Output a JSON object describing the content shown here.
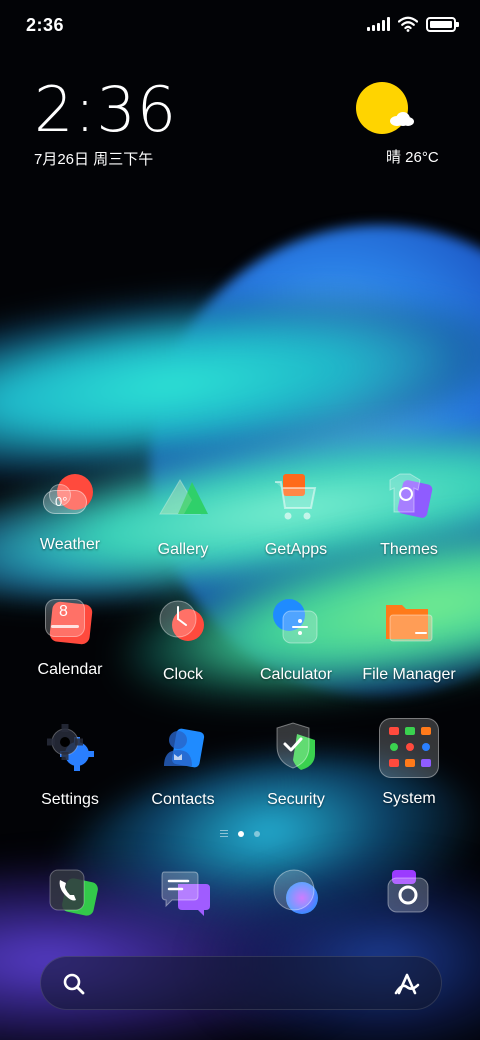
{
  "status_bar": {
    "time": "2:36",
    "icons": [
      "signal-icon",
      "wifi-icon",
      "battery-icon"
    ],
    "battery_level": 1.0
  },
  "clock_widget": {
    "time": "2:36",
    "date": "7月26日 周三下午"
  },
  "weather_widget": {
    "icon": "sun-cloud-icon",
    "text": "晴 26°C",
    "sun_color": "#ffd400"
  },
  "apps": [
    {
      "label": "Weather",
      "icon": "weather-icon",
      "badge": "0°"
    },
    {
      "label": "Gallery",
      "icon": "gallery-icon"
    },
    {
      "label": "GetApps",
      "icon": "getapps-icon"
    },
    {
      "label": "Themes",
      "icon": "themes-icon"
    },
    {
      "label": "Calendar",
      "icon": "calendar-icon",
      "badge": "8"
    },
    {
      "label": "Clock",
      "icon": "clock-icon"
    },
    {
      "label": "Calculator",
      "icon": "calculator-icon"
    },
    {
      "label": "File Manager",
      "icon": "file-manager-icon"
    },
    {
      "label": "Settings",
      "icon": "settings-icon"
    },
    {
      "label": "Contacts",
      "icon": "contacts-icon"
    },
    {
      "label": "Security",
      "icon": "security-icon"
    },
    {
      "label": "System",
      "icon": "system-folder-icon"
    }
  ],
  "page_indicator": {
    "pages": 2,
    "active_page": 1
  },
  "dock": [
    {
      "icon": "phone-icon"
    },
    {
      "icon": "messages-icon"
    },
    {
      "icon": "browser-icon"
    },
    {
      "icon": "camera-icon"
    }
  ],
  "search_bar": {
    "left_icon": "search-icon",
    "right_icon": "assistant-icon"
  },
  "colors": {
    "weather_red": "#ff4a3d",
    "gallery_green": "#2fd06a",
    "getapps_orange": "#ff6a1a",
    "themes_purple": "#8f5cff",
    "calendar_red": "#ff4a3d",
    "calculator_blue": "#1f8bff",
    "file_orange": "#ff7a1a",
    "settings_blue": "#2a7fff",
    "security_green": "#3ad24f",
    "phone_green": "#33c94a",
    "message_purple": "#a05cff",
    "browser_blue": "#3a8cff",
    "camera_purple": "#9b3bff"
  }
}
